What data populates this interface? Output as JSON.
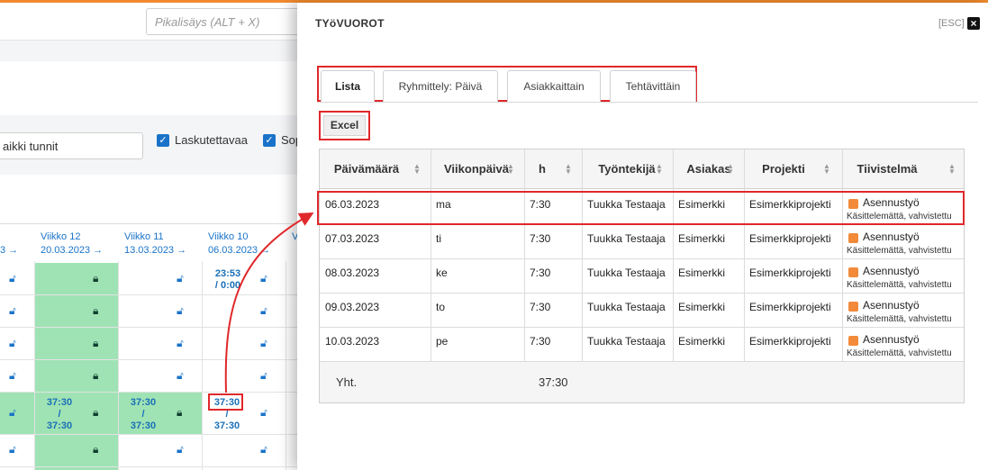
{
  "quick_add": {
    "placeholder": "Pikalisäys (ALT + X)"
  },
  "filters": {
    "all_hours": "aikki tunnit",
    "checkbox1_label": "Laskutettavaa",
    "checkbox2_label": "Sop"
  },
  "weeks": [
    {
      "label": "3 →",
      "date": ""
    },
    {
      "label": "Viikko 12",
      "date": "20.03.2023 →"
    },
    {
      "label": "Viikko 11",
      "date": "13.03.2023 →"
    },
    {
      "label": "Viikko 10",
      "date": "06.03.2023 →"
    },
    {
      "label": "V",
      "date": ""
    }
  ],
  "grid_times": {
    "w10_first": "23:53",
    "w10_first_b": "/ 0:00",
    "w12_total_a": "37:30",
    "w12_total_sep": "/",
    "w12_total_b": "37:30",
    "w11_total_a": "37:30",
    "w11_total_sep": "/",
    "w11_total_b": "37:30",
    "w10_total_a": "37:30",
    "w10_total_sep": "/",
    "w10_total_b": "37:30"
  },
  "modal": {
    "title": "TYöVUOROT",
    "esc_label": "[ESC]",
    "close_icon": "×",
    "tabs": [
      "Lista",
      "Ryhmittely: Päivä",
      "Asiakkaittain",
      "Tehtävittäin"
    ],
    "excel_label": "Excel",
    "columns": [
      "Päivämäärä",
      "Viikonpäivä",
      "h",
      "Työntekijä",
      "Asiakas",
      "Projekti",
      "Tiivistelmä"
    ],
    "rows": [
      {
        "date": "06.03.2023",
        "day": "ma",
        "h": "7:30",
        "employee": "Tuukka Testaaja",
        "client": "Esimerkki",
        "project": "Esimerkkiprojekti",
        "summary": "Asennustyö",
        "status": "Käsittelemättä, vahvistettu"
      },
      {
        "date": "07.03.2023",
        "day": "ti",
        "h": "7:30",
        "employee": "Tuukka Testaaja",
        "client": "Esimerkki",
        "project": "Esimerkkiprojekti",
        "summary": "Asennustyö",
        "status": "Käsittelemättä, vahvistettu"
      },
      {
        "date": "08.03.2023",
        "day": "ke",
        "h": "7:30",
        "employee": "Tuukka Testaaja",
        "client": "Esimerkki",
        "project": "Esimerkkiprojekti",
        "summary": "Asennustyö",
        "status": "Käsittelemättä, vahvistettu"
      },
      {
        "date": "09.03.2023",
        "day": "to",
        "h": "7:30",
        "employee": "Tuukka Testaaja",
        "client": "Esimerkki",
        "project": "Esimerkkiprojekti",
        "summary": "Asennustyö",
        "status": "Käsittelemättä, vahvistettu"
      },
      {
        "date": "10.03.2023",
        "day": "pe",
        "h": "7:30",
        "employee": "Tuukka Testaaja",
        "client": "Esimerkki",
        "project": "Esimerkkiprojekti",
        "summary": "Asennustyö",
        "status": "Käsittelemättä, vahvistettu"
      }
    ],
    "footer": {
      "label": "Yht.",
      "total": "37:30"
    }
  },
  "colors": {
    "accent_red": "#e0282b",
    "orange": "#f28a2e",
    "link_blue": "#1a73c9",
    "green": "#9fe3b4"
  }
}
